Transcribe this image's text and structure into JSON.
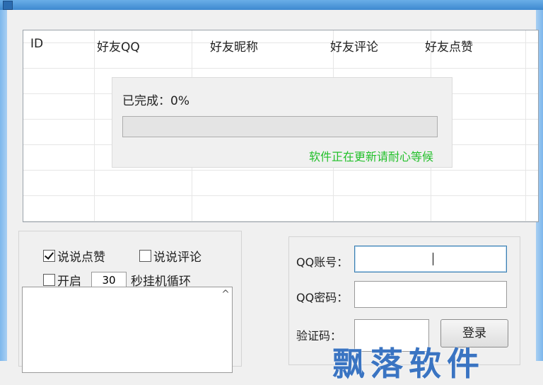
{
  "grid": {
    "columns": [
      "ID",
      "好友QQ",
      "好友昵称",
      "好友评论",
      "好友点赞"
    ]
  },
  "progress": {
    "label": "已完成：0%",
    "value": 0,
    "message": "软件正在更新请耐心等候"
  },
  "options": {
    "like_label": "说说点赞",
    "like_checked": true,
    "comment_label": "说说评论",
    "comment_checked": false,
    "start_label": "开启",
    "start_checked": false,
    "interval_value": "30",
    "interval_suffix": "秒挂机循环",
    "scroll_up_glyph": "^"
  },
  "login": {
    "account_label": "QQ账号：",
    "password_label": "QQ密码：",
    "captcha_label": "验证码：",
    "login_button": "登录"
  },
  "watermark": "飘落软件",
  "colors": {
    "progress_message": "#22c02a",
    "title_bar": "#3d88cf",
    "watermark": "#3a74c2"
  }
}
